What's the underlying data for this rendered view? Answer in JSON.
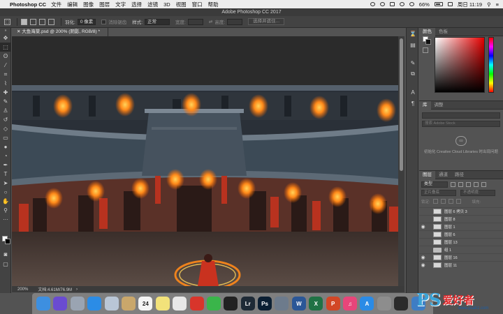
{
  "menubar": {
    "app_name": "Photoshop CC",
    "items": [
      "文件",
      "编辑",
      "图像",
      "图层",
      "文字",
      "选择",
      "滤镜",
      "3D",
      "视图",
      "窗口",
      "帮助"
    ],
    "battery": "66%",
    "clock": "周日 11:19"
  },
  "window": {
    "title": "Adobe Photoshop CC 2017"
  },
  "options": {
    "feather_label": "羽化:",
    "feather_value": "0 像素",
    "antialias_label": "消除锯齿",
    "style_label": "样式:",
    "style_value": "正常",
    "width_label": "宽度:",
    "height_label": "高度:",
    "select_mask_button": "选择并遮住..."
  },
  "document": {
    "tab_label": "大鱼海棠.psd @ 200% (阴影, RGB/8) *",
    "zoom": "200%",
    "doc_info": "文档:4.61M/76.9M"
  },
  "tools": [
    "move",
    "marquee",
    "lasso",
    "magic-wand",
    "crop",
    "eyedropper",
    "healing",
    "brush",
    "stamp",
    "history-brush",
    "eraser",
    "gradient",
    "blur",
    "dodge",
    "pen",
    "type",
    "path-select",
    "shape",
    "hand",
    "zoom"
  ],
  "color_panel": {
    "tabs": [
      "颜色",
      "色板"
    ],
    "hue_color": "#e60000"
  },
  "library_panel": {
    "tabs": [
      "库",
      "调整"
    ],
    "search_placeholder": "搜索 Adobe Stock",
    "message": "初始化 Creative Cloud Libraries 时出现问题"
  },
  "layers_panel": {
    "tabs": [
      "图层",
      "通道",
      "路径"
    ],
    "kind_filter": "类型",
    "blend_mode": "正片叠底",
    "opacity_label": "不透明度:",
    "lock_label": "锁定:",
    "fill_label": "填充:",
    "layers": [
      {
        "name": "图层 6 拷贝 3",
        "visible": false,
        "type": "layer"
      },
      {
        "name": "图层 8",
        "visible": false,
        "type": "layer"
      },
      {
        "name": "图层 1",
        "visible": true,
        "type": "layer"
      },
      {
        "name": "图层 6",
        "visible": false,
        "type": "layer"
      },
      {
        "name": "图层 13",
        "visible": false,
        "type": "layer"
      },
      {
        "name": "组 1",
        "visible": false,
        "type": "group"
      },
      {
        "name": "图层 16",
        "visible": true,
        "type": "layer"
      },
      {
        "name": "图层 11",
        "visible": true,
        "type": "layer"
      }
    ]
  },
  "dock": {
    "apps": [
      {
        "name": "finder-icon",
        "label": "",
        "color": "#3d8fe0"
      },
      {
        "name": "siri-icon",
        "label": "",
        "color": "#6a4bd1"
      },
      {
        "name": "launchpad-icon",
        "label": "",
        "color": "#9aa4b2"
      },
      {
        "name": "safari-icon",
        "label": "",
        "color": "#2b8ce6"
      },
      {
        "name": "mail-icon",
        "label": "",
        "color": "#b9c6d6"
      },
      {
        "name": "notes-icon",
        "label": "",
        "color": "#c9a76b"
      },
      {
        "name": "calendar-icon",
        "label": "24",
        "color": "#f4f4f4"
      },
      {
        "name": "stickies-icon",
        "label": "",
        "color": "#f2e27a"
      },
      {
        "name": "photos-icon",
        "label": "",
        "color": "#e8e8e8"
      },
      {
        "name": "netease-music-icon",
        "label": "",
        "color": "#d8352b"
      },
      {
        "name": "wechat-icon",
        "label": "",
        "color": "#3ab54a"
      },
      {
        "name": "qq-icon",
        "label": "",
        "color": "#222222"
      },
      {
        "name": "lightroom-icon",
        "label": "Lr",
        "color": "#1e2a36"
      },
      {
        "name": "photoshop-icon",
        "label": "Ps",
        "color": "#0b1f33"
      },
      {
        "name": "screenshot-app-icon",
        "label": "",
        "color": "#6d7b8c"
      },
      {
        "name": "word-icon",
        "label": "W",
        "color": "#2b5797"
      },
      {
        "name": "excel-icon",
        "label": "X",
        "color": "#207245"
      },
      {
        "name": "powerpoint-icon",
        "label": "P",
        "color": "#d24726"
      },
      {
        "name": "itunes-icon",
        "label": "♫",
        "color": "#e8457a"
      },
      {
        "name": "app-store-icon",
        "label": "A",
        "color": "#2a8be6"
      },
      {
        "name": "system-preferences-icon",
        "label": "",
        "color": "#8d8d8d"
      },
      {
        "name": "activity-monitor-icon",
        "label": "",
        "color": "#2b2b2b"
      },
      {
        "name": "time-machine-icon",
        "label": "",
        "color": "#3e7dc4"
      }
    ]
  },
  "watermark": {
    "ps": "PS",
    "text": "爱好者",
    "url": "www.psahz.com"
  }
}
